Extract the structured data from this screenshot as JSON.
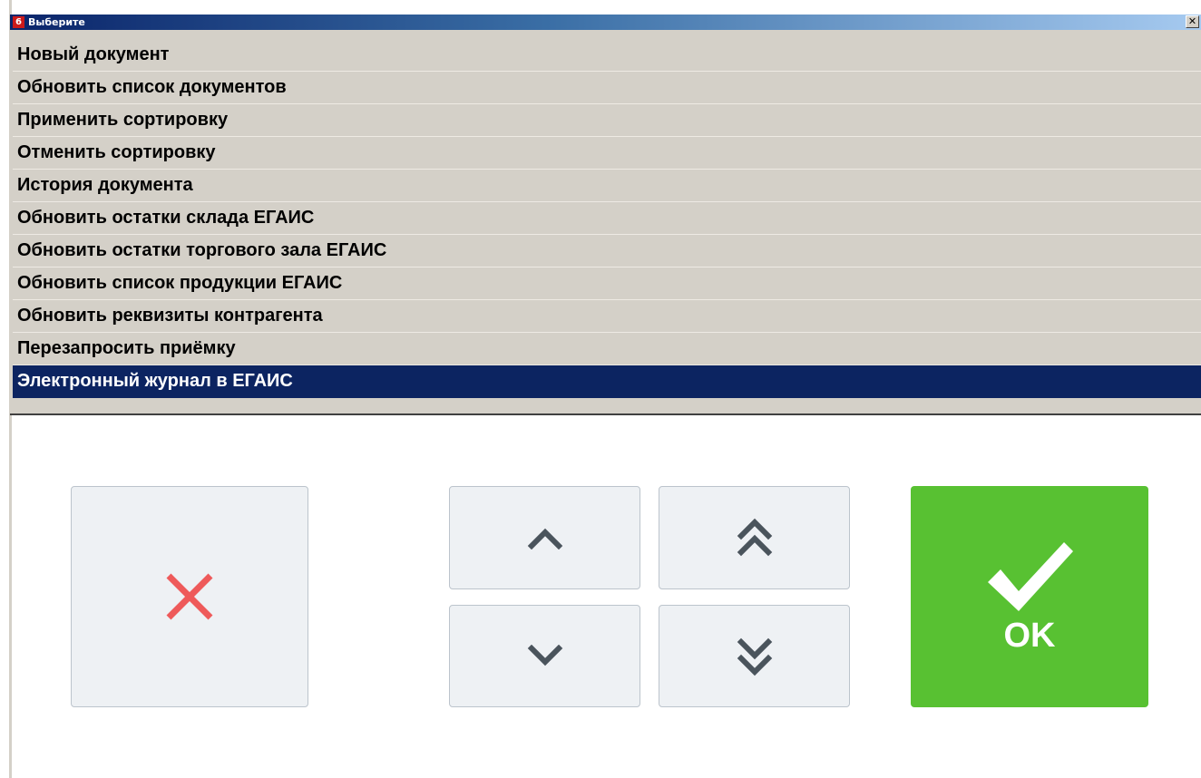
{
  "window": {
    "icon_glyph": "6",
    "title": "Выберите",
    "close_glyph": "✕"
  },
  "menu": {
    "items": [
      {
        "label": "Новый документ"
      },
      {
        "label": "Обновить список документов"
      },
      {
        "label": "Применить сортировку"
      },
      {
        "label": "Отменить сортировку"
      },
      {
        "label": "История документа"
      },
      {
        "label": "Обновить остатки склада ЕГАИС"
      },
      {
        "label": "Обновить остатки торгового зала ЕГАИС"
      },
      {
        "label": "Обновить список продукции ЕГАИС"
      },
      {
        "label": "Обновить реквизиты контрагента"
      },
      {
        "label": "Перезапросить приёмку"
      },
      {
        "label": "Электронный журнал в ЕГАИС"
      }
    ],
    "selected_index": 10
  },
  "buttons": {
    "cancel_icon": "close-icon",
    "up_icon": "chevron-up-icon",
    "page_up_icon": "double-chevron-up-icon",
    "down_icon": "chevron-down-icon",
    "page_down_icon": "double-chevron-down-icon",
    "ok_icon": "checkmark-icon",
    "ok_label": "OK"
  },
  "colors": {
    "selection": "#0c2461",
    "ok_button": "#58c132",
    "cancel_x": "#ee5a5a",
    "arrow": "#4a545c"
  }
}
